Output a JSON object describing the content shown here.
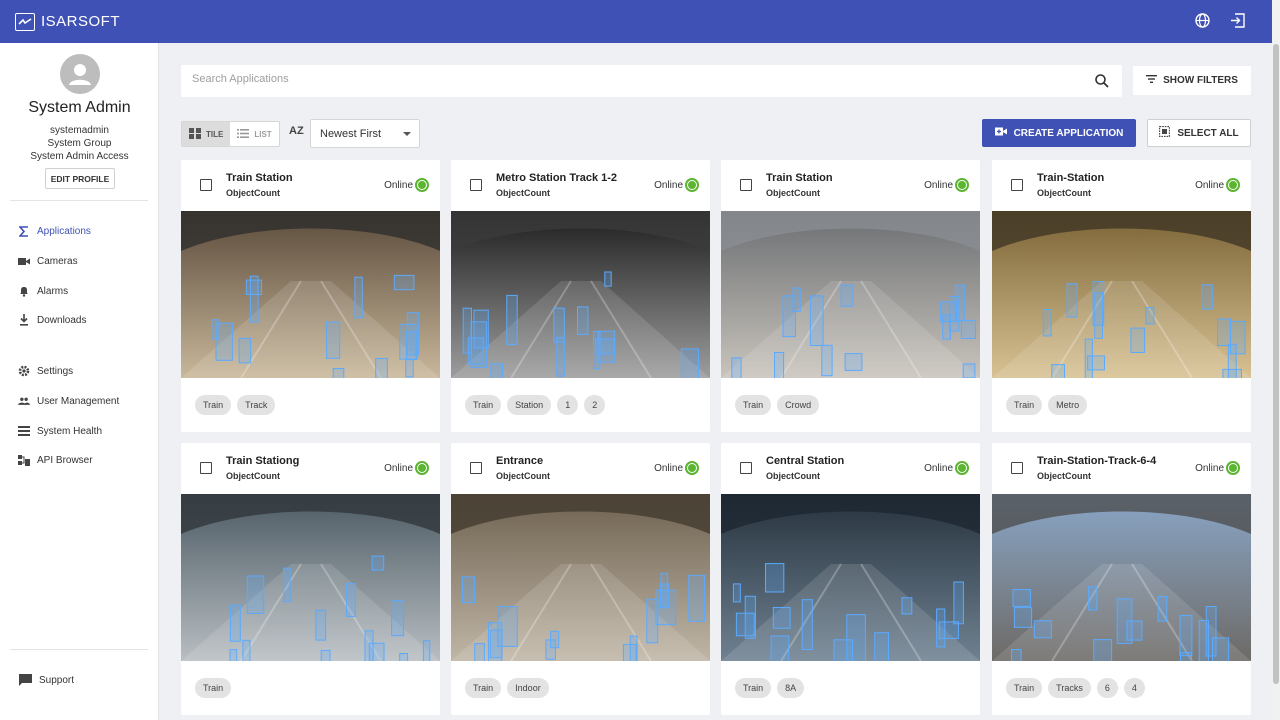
{
  "app": {
    "brand": "ISARSOFT"
  },
  "user": {
    "name": "System Admin",
    "username": "systemadmin",
    "group": "System Group",
    "access": "System Admin Access",
    "edit_label": "EDIT PROFILE"
  },
  "nav": {
    "items": [
      {
        "label": "Applications",
        "icon": "sigma-icon",
        "active": true
      },
      {
        "label": "Cameras",
        "icon": "camera-icon"
      },
      {
        "label": "Alarms",
        "icon": "bell-icon"
      },
      {
        "label": "Downloads",
        "icon": "download-icon"
      },
      {
        "label": "Settings",
        "icon": "gear-icon"
      },
      {
        "label": "User Management",
        "icon": "people-icon"
      },
      {
        "label": "System Health",
        "icon": "list-icon"
      },
      {
        "label": "API Browser",
        "icon": "api-icon"
      }
    ],
    "support_label": "Support"
  },
  "search": {
    "placeholder": "Search Applications",
    "filters_label": "SHOW FILTERS"
  },
  "toolbar": {
    "tile_label": "TILE",
    "list_label": "LIST",
    "sort_icon": "AZ",
    "sort_value": "Newest First",
    "create_label": "CREATE APPLICATION",
    "select_all_label": "SELECT ALL"
  },
  "colors": {
    "primary": "#3f51b5",
    "online": "#5bb531"
  },
  "cards": [
    {
      "title": "Train Station",
      "type": "ObjectCount",
      "status": "Online",
      "tags": [
        "Train",
        "Track"
      ]
    },
    {
      "title": "Metro Station Track 1-2",
      "type": "ObjectCount",
      "status": "Online",
      "tags": [
        "Train",
        "Station",
        "1",
        "2"
      ]
    },
    {
      "title": "Train Station",
      "type": "ObjectCount",
      "status": "Online",
      "tags": [
        "Train",
        "Crowd"
      ]
    },
    {
      "title": "Train-Station",
      "type": "ObjectCount",
      "status": "Online",
      "tags": [
        "Train",
        "Metro"
      ]
    },
    {
      "title": "Train Stationg",
      "type": "ObjectCount",
      "status": "Online",
      "tags": [
        "Train"
      ]
    },
    {
      "title": "Entrance",
      "type": "ObjectCount",
      "status": "Online",
      "tags": [
        "Train",
        "Indoor"
      ]
    },
    {
      "title": "Central Station",
      "type": "ObjectCount",
      "status": "Online",
      "tags": [
        "Train",
        "8A"
      ]
    },
    {
      "title": "Train-Station-Track-6-4",
      "type": "ObjectCount",
      "status": "Online",
      "tags": [
        "Train",
        "Tracks",
        "6",
        "4"
      ]
    }
  ]
}
